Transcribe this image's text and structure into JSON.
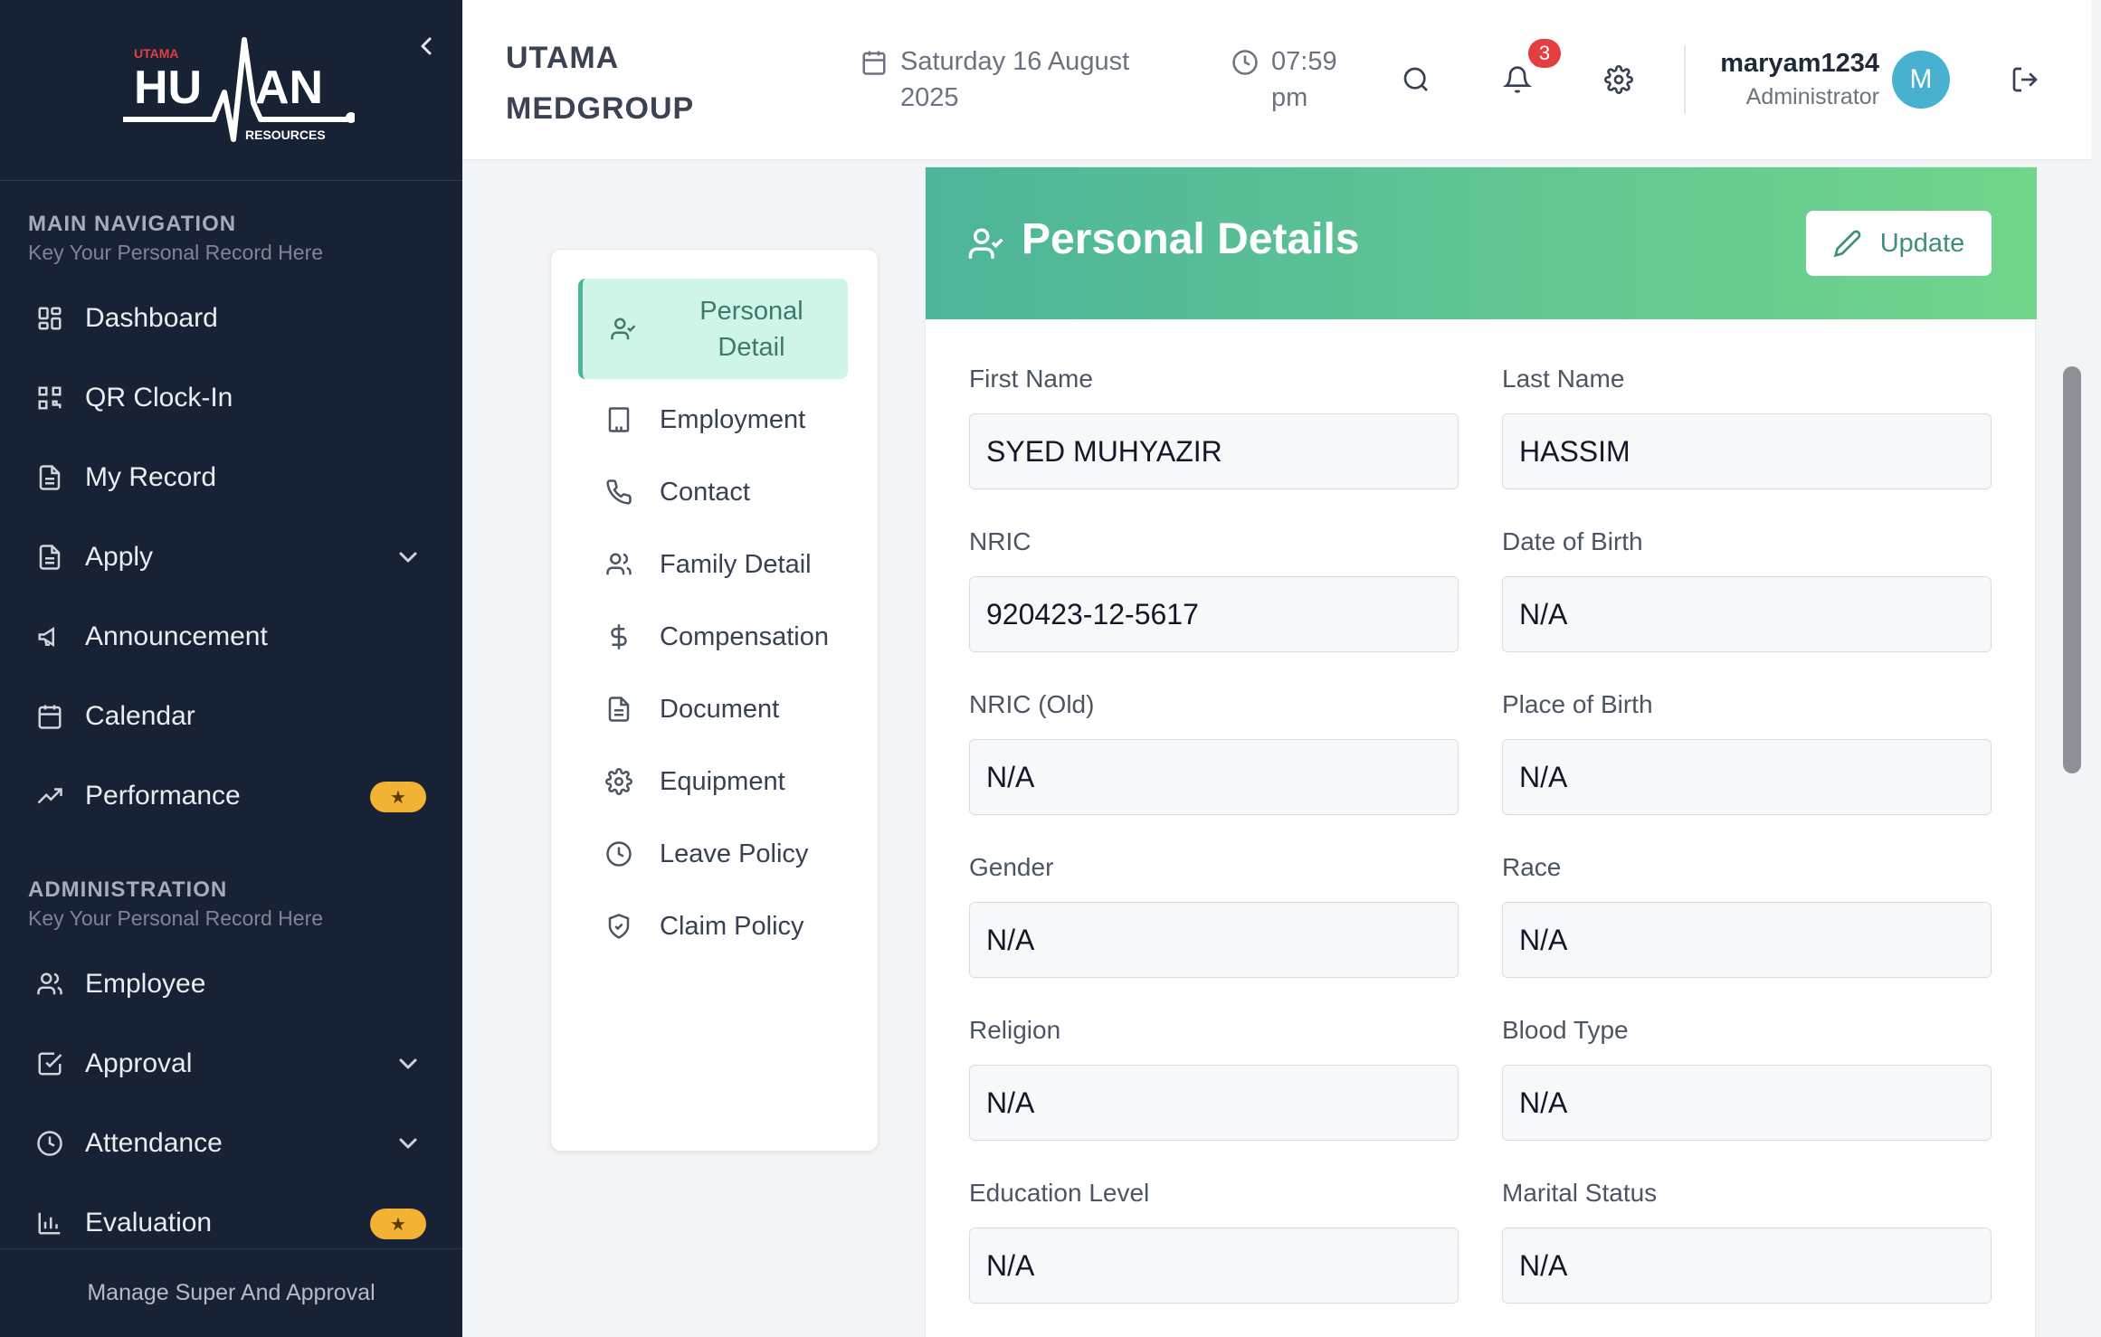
{
  "brand": {
    "small": "UTAMA",
    "big_left": "HU",
    "big_right": "AN",
    "sub": "RESOURCES"
  },
  "sidebar": {
    "main_nav_title": "MAIN NAVIGATION",
    "main_nav_sub": "Key Your Personal Record Here",
    "main_items": [
      {
        "label": "Dashboard",
        "icon": "dashboard-icon"
      },
      {
        "label": "QR Clock-In",
        "icon": "qr-code-icon"
      },
      {
        "label": "My Record",
        "icon": "file-icon"
      },
      {
        "label": "Apply",
        "icon": "file-icon",
        "dropdown": true
      },
      {
        "label": "Announcement",
        "icon": "megaphone-icon"
      },
      {
        "label": "Calendar",
        "icon": "calendar-icon"
      },
      {
        "label": "Performance",
        "icon": "trending-up-icon",
        "badge": "★"
      }
    ],
    "admin_title": "ADMINISTRATION",
    "admin_sub": "Key Your Personal Record Here",
    "admin_items": [
      {
        "label": "Employee",
        "icon": "users-icon"
      },
      {
        "label": "Approval",
        "icon": "check-square-icon",
        "dropdown": true
      },
      {
        "label": "Attendance",
        "icon": "clock-icon",
        "dropdown": true
      },
      {
        "label": "Evaluation",
        "icon": "bar-chart-icon",
        "badge": "★"
      }
    ],
    "footer": "Manage Super And Approval"
  },
  "header": {
    "company": "UTAMA MEDGROUP",
    "date": "Saturday 16 August 2025",
    "time": "07:59 pm",
    "notification_count": "3",
    "user_name": "maryam1234",
    "user_role": "Administrator",
    "avatar_initial": "M"
  },
  "submenu": [
    {
      "label": "Personal Detail",
      "icon": "user-check-icon",
      "active": true
    },
    {
      "label": "Employment",
      "icon": "building-icon"
    },
    {
      "label": "Contact",
      "icon": "phone-icon"
    },
    {
      "label": "Family Detail",
      "icon": "users-icon"
    },
    {
      "label": "Compensation",
      "icon": "dollar-icon"
    },
    {
      "label": "Document",
      "icon": "document-icon"
    },
    {
      "label": "Equipment",
      "icon": "gear-icon"
    },
    {
      "label": "Leave Policy",
      "icon": "clock-icon"
    },
    {
      "label": "Claim Policy",
      "icon": "shield-check-icon"
    }
  ],
  "card": {
    "title": "Personal Details",
    "update_label": "Update",
    "fields": [
      {
        "label": "First Name",
        "value": "SYED MUHYAZIR"
      },
      {
        "label": "Last Name",
        "value": "HASSIM"
      },
      {
        "label": "NRIC",
        "value": "920423-12-5617"
      },
      {
        "label": "Date of Birth",
        "value": "N/A"
      },
      {
        "label": "NRIC (Old)",
        "value": "N/A"
      },
      {
        "label": "Place of Birth",
        "value": "N/A"
      },
      {
        "label": "Gender",
        "value": "N/A"
      },
      {
        "label": "Race",
        "value": "N/A"
      },
      {
        "label": "Religion",
        "value": "N/A"
      },
      {
        "label": "Blood Type",
        "value": "N/A"
      },
      {
        "label": "Education Level",
        "value": "N/A"
      },
      {
        "label": "Marital Status",
        "value": "N/A"
      }
    ]
  },
  "colors": {
    "sidebar_bg": "#182235",
    "accent_green": "#4db59a",
    "badge_yellow": "#f2b233",
    "notif_red": "#e53e3e",
    "avatar_blue": "#47b1cf"
  }
}
